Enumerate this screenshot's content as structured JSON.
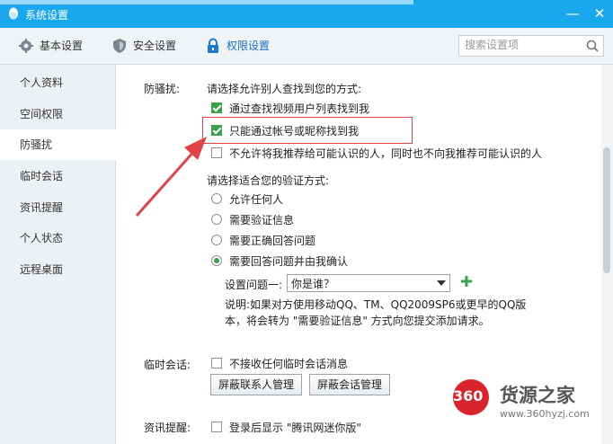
{
  "window": {
    "title": "系统设置",
    "minimize": "—",
    "close": "✕"
  },
  "toolbar": {
    "tabs": [
      {
        "label": "基本设置",
        "icon": "gear-icon"
      },
      {
        "label": "安全设置",
        "icon": "shield-icon"
      },
      {
        "label": "权限设置",
        "icon": "lock-icon",
        "active": true
      }
    ],
    "search_placeholder": "搜索设置项"
  },
  "sidebar": {
    "items": [
      {
        "label": "个人资料"
      },
      {
        "label": "空间权限"
      },
      {
        "label": "防骚扰",
        "active": true
      },
      {
        "label": "临时会话"
      },
      {
        "label": "资讯提醒"
      },
      {
        "label": "个人状态"
      },
      {
        "label": "远程桌面"
      }
    ]
  },
  "anti_harass": {
    "section_label": "防骚扰:",
    "find_prompt": "请选择允许别人查找到您的方式:",
    "find_options": [
      {
        "label": "通过查找视频用户列表找到我",
        "checked": true
      },
      {
        "label": "只能通过帐号或昵称找到我",
        "checked": true
      },
      {
        "label": "不允许将我推荐给可能认识的人，同时也不向我推荐可能认识的人",
        "checked": false
      }
    ],
    "verify_prompt": "请选择适合您的验证方式:",
    "verify_options": [
      {
        "label": "允许任何人",
        "selected": false
      },
      {
        "label": "需要验证信息",
        "selected": false
      },
      {
        "label": "需要正确回答问题",
        "selected": false
      },
      {
        "label": "需要回答问题并由我确认",
        "selected": true
      }
    ],
    "question_label": "设置问题一:",
    "question_value": "你是谁？",
    "note_line1": "说明:如果对方使用移动QQ、TM、QQ2009SP6或更早的QQ版",
    "note_line2": "本，将会转为 \"需要验证信息\" 方式向您提交添加请求。"
  },
  "temp_session": {
    "section_label": "临时会话:",
    "option": "不接收任何临时会话消息",
    "btn_contacts": "屏蔽联系人管理",
    "btn_sessions": "屏蔽会话管理"
  },
  "news": {
    "section_label": "资讯提醒:",
    "option": "登录后显示 \"腾讯网迷你版\""
  },
  "watermark": {
    "logo": "360",
    "brand": "货源之家",
    "url": "www.360hyzj.com"
  },
  "colors": {
    "titlebar": "#19a8ee",
    "check": "#3aa34a",
    "highlight": "#e04444",
    "active_tab": "#1a6fc4"
  }
}
